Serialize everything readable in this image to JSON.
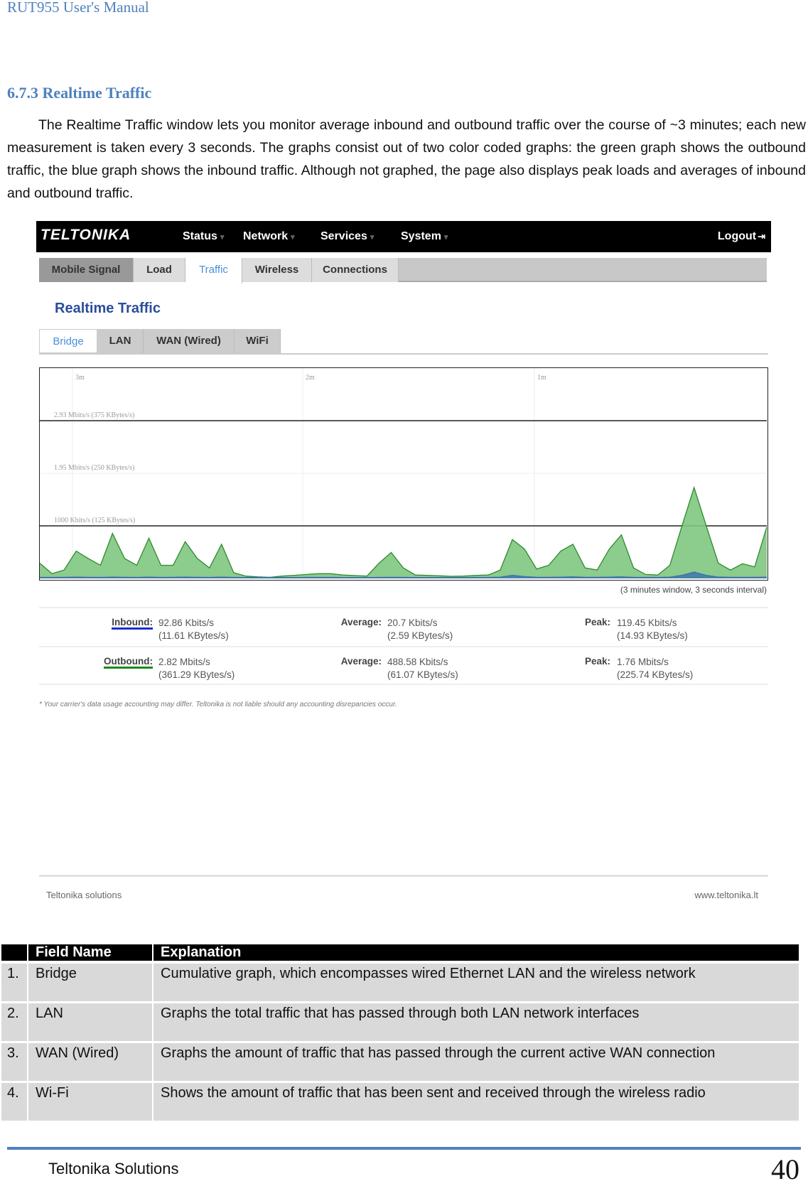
{
  "doc_header": "RUT955 User's Manual",
  "section_title": "6.7.3 Realtime Traffic",
  "paragraph": "The Realtime Traffic window lets you monitor average inbound and outbound traffic over the course of ~3 minutes; each new measurement is taken every 3 seconds. The graphs consist out of two color coded graphs: the green graph shows the outbound traffic, the blue graph shows the inbound traffic. Although not graphed, the page also displays peak loads and averages of inbound and outbound traffic.",
  "router": {
    "logo": "TELTONIKA",
    "nav": [
      "Status",
      "Network",
      "Services",
      "System"
    ],
    "logout": "Logout",
    "tabs": [
      "Mobile Signal",
      "Load",
      "Traffic",
      "Wireless",
      "Connections"
    ],
    "active_tab": "Traffic",
    "page_title": "Realtime Traffic",
    "subtabs": [
      "Bridge",
      "LAN",
      "WAN (Wired)",
      "WiFi"
    ],
    "active_subtab": "Bridge",
    "caption": "(3 minutes window, 3 seconds interval)",
    "inbound": {
      "label": "Inbound:",
      "current": "92.86 Kbits/s",
      "current_bytes": "(11.61 KBytes/s)",
      "avg_label": "Average:",
      "avg": "20.7 Kbits/s",
      "avg_bytes": "(2.59 KBytes/s)",
      "peak_label": "Peak:",
      "peak": "119.45 Kbits/s",
      "peak_bytes": "(14.93 KBytes/s)"
    },
    "outbound": {
      "label": "Outbound:",
      "current": "2.82 Mbits/s",
      "current_bytes": "(361.29 KBytes/s)",
      "avg_label": "Average:",
      "avg": "488.58 Kbits/s",
      "avg_bytes": "(61.07 KBytes/s)",
      "peak_label": "Peak:",
      "peak": "1.76 Mbits/s",
      "peak_bytes": "(225.74 KBytes/s)"
    },
    "disclaimer": "* Your carrier's data usage accounting may differ. Teltonika is not liable should any accounting disrepancies occur.",
    "footer_left": "Teltonika solutions",
    "footer_right": "www.teltonika.lt"
  },
  "chart_data": {
    "type": "area",
    "x_tick_labels": [
      "3m",
      "2m",
      "1m"
    ],
    "y_tick_labels": [
      "2.93 Mbits/s (375 KBytes/s)",
      "1.95 Mbits/s (250 KBytes/s)",
      "1000 Kbits/s (125 KBytes/s)"
    ],
    "y_ticks_kbits": [
      3000,
      2000,
      1000
    ],
    "ylim_kbits": [
      0,
      4000
    ],
    "interval_s": 3,
    "colors": {
      "outbound": "#7fc77f",
      "outbound_line": "#2e8b2e",
      "inbound": "#3a6fb0"
    },
    "series": [
      {
        "key": "outbound",
        "values": [
          290,
          90,
          160,
          520,
          380,
          250,
          855,
          380,
          250,
          765,
          250,
          250,
          700,
          380,
          200,
          650,
          110,
          45,
          30,
          22,
          45,
          60,
          75,
          90,
          90,
          65,
          55,
          45,
          290,
          495,
          200,
          65,
          60,
          50,
          40,
          45,
          60,
          65,
          160,
          740,
          560,
          180,
          250,
          520,
          650,
          200,
          160,
          560,
          830,
          200,
          75,
          65,
          250,
          1000,
          1730,
          1000,
          290,
          160,
          280,
          220,
          980
        ]
      },
      {
        "key": "inbound",
        "values": [
          20,
          20,
          22,
          25,
          22,
          20,
          25,
          22,
          20,
          25,
          20,
          22,
          25,
          22,
          20,
          25,
          20,
          18,
          18,
          18,
          18,
          18,
          20,
          20,
          20,
          18,
          18,
          18,
          20,
          22,
          20,
          18,
          18,
          18,
          18,
          18,
          20,
          20,
          25,
          60,
          35,
          22,
          22,
          25,
          30,
          22,
          22,
          25,
          30,
          22,
          20,
          20,
          25,
          60,
          120,
          60,
          25,
          22,
          22,
          22,
          25
        ]
      }
    ]
  },
  "table": {
    "headers": [
      "",
      "Field Name",
      "Explanation"
    ],
    "rows": [
      [
        "1.",
        "Bridge",
        "Cumulative graph, which encompasses wired Ethernet LAN and the wireless network"
      ],
      [
        "2.",
        "LAN",
        "Graphs the total traffic that has passed through both LAN network interfaces"
      ],
      [
        "3.",
        "WAN (Wired)",
        "Graphs the amount of traffic that has passed through the current active WAN connection"
      ],
      [
        "4.",
        "Wi-Fi",
        "Shows the amount of traffic that has been sent and received through the wireless radio"
      ]
    ]
  },
  "page_footer": {
    "company": "Teltonika Solutions",
    "page": "40"
  }
}
